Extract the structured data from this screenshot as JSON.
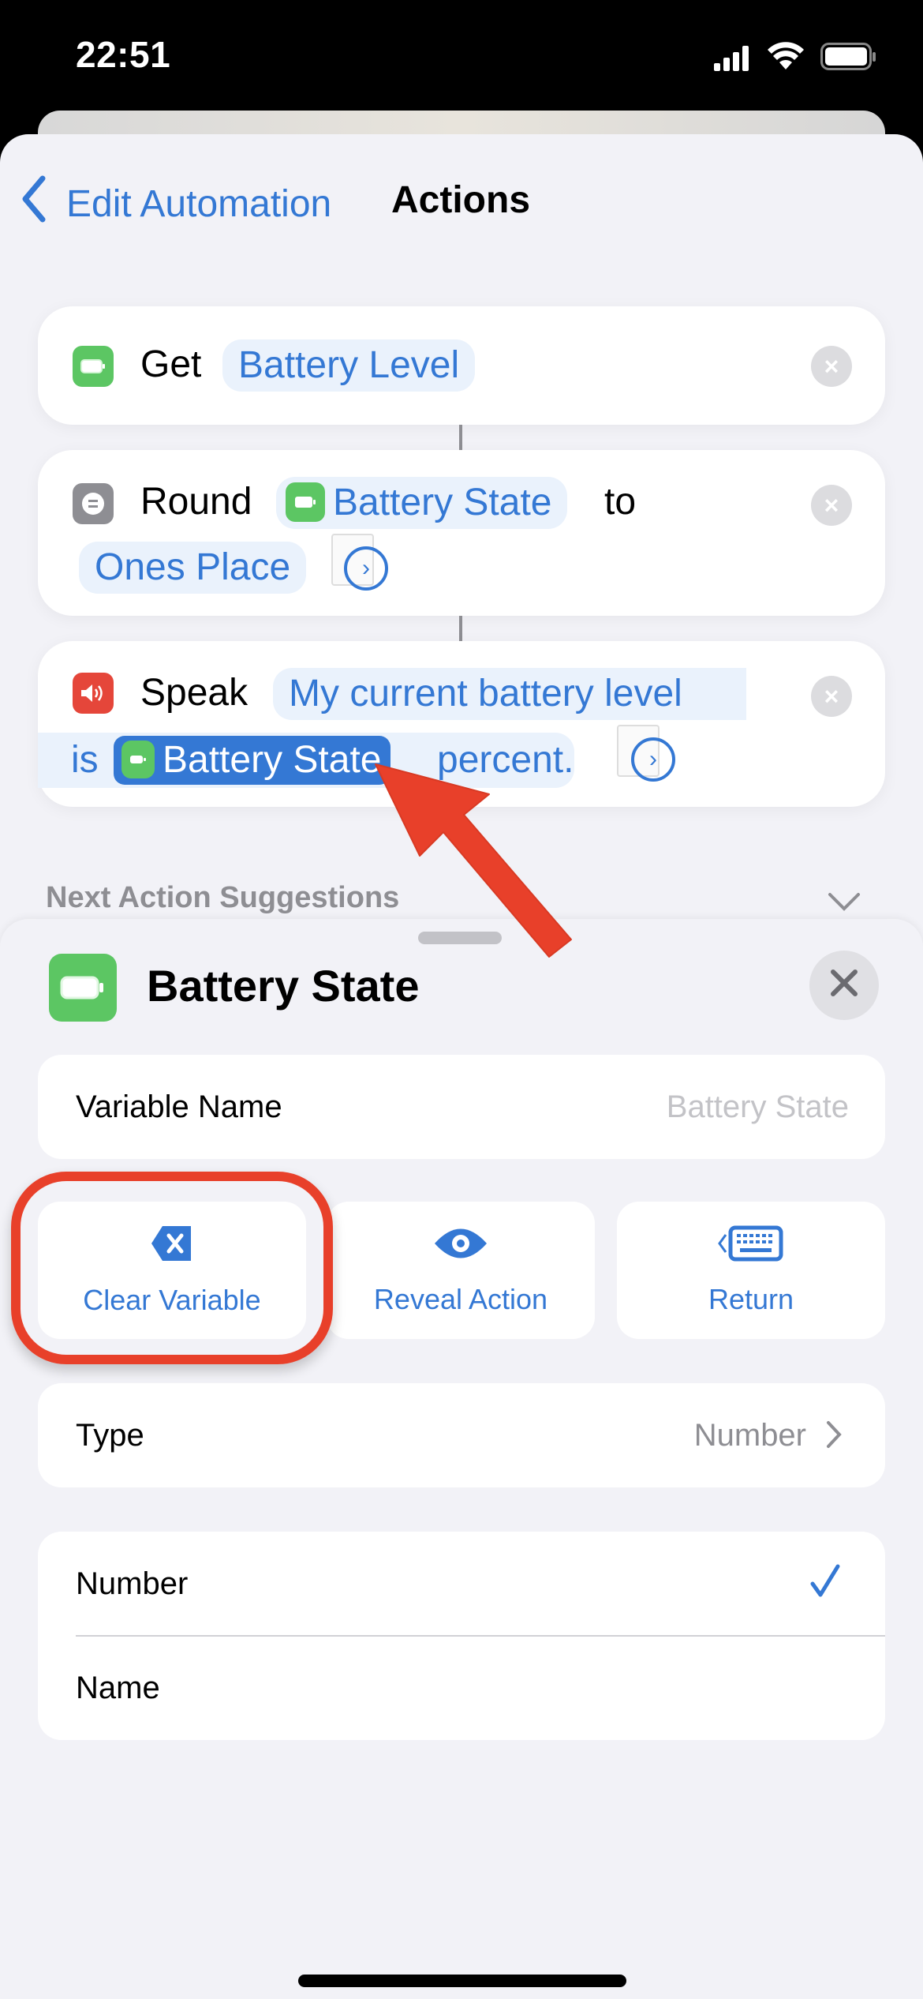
{
  "status_bar": {
    "time": "22:51",
    "icons": [
      "cellular-signal-icon",
      "wifi-icon",
      "battery-icon"
    ]
  },
  "nav": {
    "back_label": "Edit Automation",
    "title": "Actions"
  },
  "actions": [
    {
      "verb": "Get",
      "icon": "battery-icon",
      "icon_color": "#5cc663",
      "tokens": [
        "Battery Level"
      ]
    },
    {
      "verb": "Round",
      "icon": "calculator-icon",
      "icon_color": "#8e8e93",
      "variable": "Battery State",
      "connector": "to",
      "parameter": "Ones Place"
    },
    {
      "verb": "Speak",
      "icon": "speaker-icon",
      "icon_color": "#e5463a",
      "text_before": "My current battery level",
      "text_is": "is",
      "variable": "Battery State",
      "text_after": "percent."
    }
  ],
  "next_action_suggestions": "Next Action Suggestions",
  "drawer": {
    "title": "Battery State",
    "variable_name_label": "Variable Name",
    "variable_name_placeholder": "Battery State",
    "buttons": [
      {
        "label": "Clear Variable",
        "icon": "clear-delete-icon"
      },
      {
        "label": "Reveal Action",
        "icon": "eye-icon"
      },
      {
        "label": "Return",
        "icon": "keyboard-return-icon"
      }
    ],
    "type_label": "Type",
    "type_value": "Number",
    "options": [
      {
        "label": "Number",
        "selected": true
      },
      {
        "label": "Name",
        "selected": false
      }
    ]
  },
  "colors": {
    "accent": "#3478d4",
    "annotation": "#e8402a",
    "battery_green": "#5cc663"
  },
  "annotations": {
    "arrow_target": "Battery State variable token",
    "highlight_target": "Clear Variable button"
  }
}
